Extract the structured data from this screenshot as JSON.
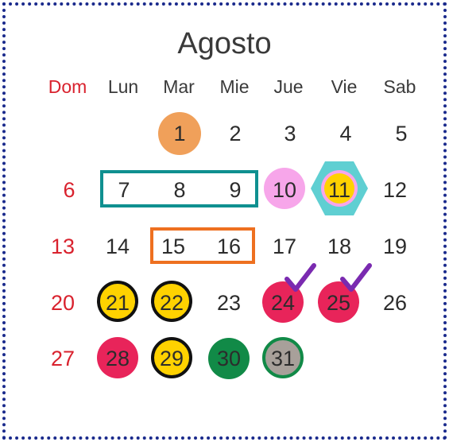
{
  "calendar": {
    "month": "Agosto",
    "weekdays": [
      "Dom",
      "Lun",
      "Mar",
      "Mie",
      "Jue",
      "Vie",
      "Sab"
    ],
    "dates": {
      "d1": "1",
      "d2": "2",
      "d3": "3",
      "d4": "4",
      "d5": "5",
      "d6": "6",
      "d7": "7",
      "d8": "8",
      "d9": "9",
      "d10": "10",
      "d11": "11",
      "d12": "12",
      "d13": "13",
      "d14": "14",
      "d15": "15",
      "d16": "16",
      "d17": "17",
      "d18": "18",
      "d19": "19",
      "d20": "20",
      "d21": "21",
      "d22": "22",
      "d23": "23",
      "d24": "24",
      "d25": "25",
      "d26": "26",
      "d27": "27",
      "d28": "28",
      "d29": "29",
      "d30": "30",
      "d31": "31"
    }
  },
  "colors": {
    "frame": "#1a2a8c",
    "sunday": "#d9222e",
    "orange_circle": "#f0a05a",
    "pink_circle": "#f7a6ea",
    "hexagon": "#5fcfd2",
    "yellow": "#ffd200",
    "crimson": "#e8245a",
    "green": "#118a47",
    "gray": "#a8a09a",
    "teal_box": "#0f9090",
    "orange_box": "#ee7020",
    "check": "#7a2ab0"
  }
}
